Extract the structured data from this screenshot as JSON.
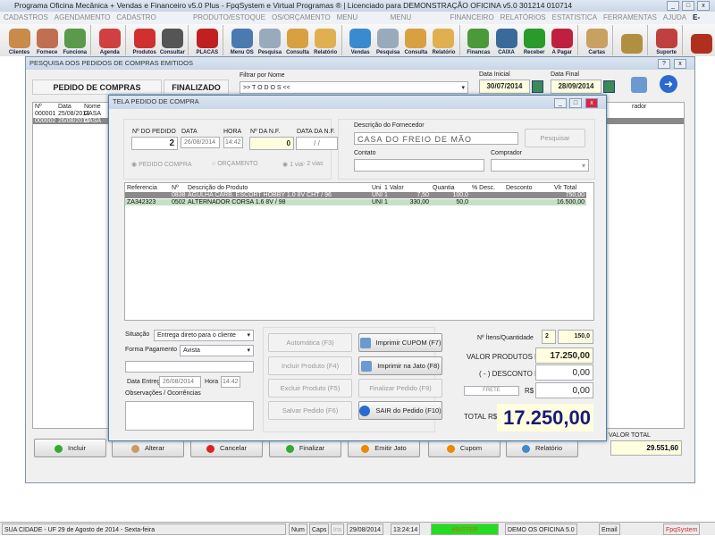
{
  "app": {
    "title": "Programa Oficina Mecânica + Vendas e Financeiro v5.0 Plus - FpqSystem e Virtual Programas ® | Licenciado para  DEMONSTRAÇÃO OFICINA v5.0 301214 010714"
  },
  "menu": [
    "CADASTROS",
    "AGENDAMENTO",
    "CADASTRO VEICULOS",
    "PRODUTO/ESTOQUE",
    "OS/ORÇAMENTO",
    "MENU VENDAS",
    "MENU COMPRAS",
    "FINANCEIRO",
    "RELATÓRIOS",
    "ESTATISTICA",
    "FERRAMENTAS",
    "AJUDA",
    "E-MAIL"
  ],
  "toolbar": [
    {
      "label": "Clientes",
      "color": "#c98a4a"
    },
    {
      "label": "Fornece",
      "color": "#c07050"
    },
    {
      "label": "Funciona",
      "color": "#5a9a4a"
    },
    {
      "sep": true
    },
    {
      "label": "Agenda",
      "color": "#d04040"
    },
    {
      "sep": true
    },
    {
      "label": "Produtos",
      "color": "#d03030"
    },
    {
      "label": "Consultar",
      "color": "#555"
    },
    {
      "sep": true
    },
    {
      "label": "PLACAS",
      "color": "#c02020"
    },
    {
      "sep": true
    },
    {
      "label": "Menu OS",
      "color": "#4a7ab0"
    },
    {
      "label": "Pesquisa",
      "color": "#9ab"
    },
    {
      "label": "Consulta",
      "color": "#d8a040"
    },
    {
      "label": "Relatório",
      "color": "#e0b050"
    },
    {
      "sep": true
    },
    {
      "label": "Vendas",
      "color": "#3a8ad0"
    },
    {
      "label": "Pesquisa",
      "color": "#9ab"
    },
    {
      "label": "Consulta",
      "color": "#d8a040"
    },
    {
      "label": "Relatório",
      "color": "#e0b050"
    },
    {
      "sep": true
    },
    {
      "label": "Financas",
      "color": "#4a9a3a"
    },
    {
      "label": "CAIXA",
      "color": "#3a6a9a"
    },
    {
      "label": "Receber",
      "color": "#2a9a2a"
    },
    {
      "label": "A Pagar",
      "color": "#c02040"
    },
    {
      "sep": true
    },
    {
      "label": "Cartas",
      "color": "#c8a060"
    },
    {
      "sep": true
    },
    {
      "label": "",
      "color": "#b09040"
    },
    {
      "sep": true
    },
    {
      "label": "Suporte",
      "color": "#c04040"
    },
    {
      "sep": true
    },
    {
      "label": "",
      "color": "#b03020"
    }
  ],
  "search": {
    "title": "PESQUISA DOS PEDIDOS DE COMPRAS EMITIDOS",
    "header_left": "PEDIDO DE COMPRAS",
    "header_status": "FINALIZADO",
    "filter_label": "Filtrar por Nome",
    "filter_value": ">> T O D O S <<",
    "date_start_label": "Data Inicial",
    "date_start": "30/07/2014",
    "date_end_label": "Data Final",
    "date_end": "28/09/2014",
    "columns": [
      "Nº",
      "Data",
      "Nome",
      "rador"
    ],
    "rows": [
      [
        "000001",
        "25/08/2014",
        "CASA"
      ],
      [
        "000002",
        "26/08/2014",
        "CASA"
      ]
    ],
    "total_label": "VALOR TOTAL",
    "total_value": "29.551,60",
    "buttons": [
      "Incluir",
      "Alterar",
      "Cancelar",
      "Finalizar",
      "Emitir Jato",
      "Cupom",
      "Relatório"
    ]
  },
  "modal": {
    "title": "TELA PEDIDO DE COMPRA",
    "order_no_label": "Nº DO PEDIDO",
    "order_no": "2",
    "date_label": "DATA",
    "date": "26/08/2014",
    "time_label": "HORA",
    "time": "14:42",
    "nf_label": "Nº DA N.F.",
    "nf": "0",
    "nf_date_label": "DATA DA N.F.",
    "nf_date": " / /",
    "radio_pedido": "PEDIDO COMPRA",
    "radio_orcamento": "ORÇAMENTO",
    "radio_1via": "1 via",
    "radio_2vias": "2 vias",
    "supplier_label": "Descrição do Fornecedor",
    "supplier": "CASA DO FREIO DE MÃO",
    "search_btn": "Pesquisar",
    "contact_label": "Contato",
    "contact": "",
    "buyer_label": "Comprador",
    "buyer": "",
    "columns": [
      "Referencia",
      "Nº",
      "Descrição do Produto",
      "Uni",
      "1 Valor",
      "Quantia",
      "% Desc.",
      "Desconto",
      "Vlr Total"
    ],
    "items": [
      [
        "",
        "0838",
        "AGULHA CARB. ESCORT HOBBY 1.0 8V CHT / 96",
        "UNI",
        "1",
        "7,50",
        "100,0",
        "",
        "",
        "750,00"
      ],
      [
        "ZA342323",
        "0502",
        "ALTERNADOR CORSA 1.6 8V / 98",
        "UNI",
        "1",
        "330,00",
        "50,0",
        "",
        "",
        "16.500,00"
      ]
    ],
    "situacao_label": "Situação",
    "situacao": "Entrega direto para o cliente",
    "pagamento_label": "Forma Pagamento",
    "pagamento": "Avista",
    "entrega_label": "Data Entrega:",
    "entrega": "26/08/2014",
    "hora_label": "Hora",
    "hora": "14:42",
    "obs_label": "Observações / Ocorrências",
    "btn_auto": "Automática   (F3)",
    "btn_incluir": "Incluir Produto (F4)",
    "btn_excluir": "Excluir Produto (F5)",
    "btn_salvar": "Salvar Pedido  (F6)",
    "btn_cupom": "Imprimir CUPOM  (F7)",
    "btn_jato": "Imprimir na Jato  (F8)",
    "btn_finalizar": "Finalizar Pedido  (F9)",
    "btn_sair": "SAIR do Pedido  (F10)",
    "itens_label": "Nº Ítens/Quantidade",
    "itens": "2",
    "quantidade": "150,0",
    "valor_label": "VALOR PRODUTOS R$",
    "valor": "17.250,00",
    "desconto_label": "( - ) DESCONTO R$",
    "desconto": "0,00",
    "frete_label": "FRETE",
    "frete_rs": "R$",
    "frete": "0,00",
    "total_label": "TOTAL  R$",
    "total": "17.250,00"
  },
  "status": {
    "city": "SUA CIDADE - UF 29 de Agosto de 2014 - Sexta-feira",
    "num": "Num",
    "caps": "Caps",
    "ins": "Ins",
    "date": "29/08/2014",
    "time": "13:24:14",
    "user": "MASTER",
    "version": "DEMO OS OFICINA 5.0",
    "email": "Email",
    "brand": "FpqSystem",
    "user_color": "#22dd22"
  }
}
